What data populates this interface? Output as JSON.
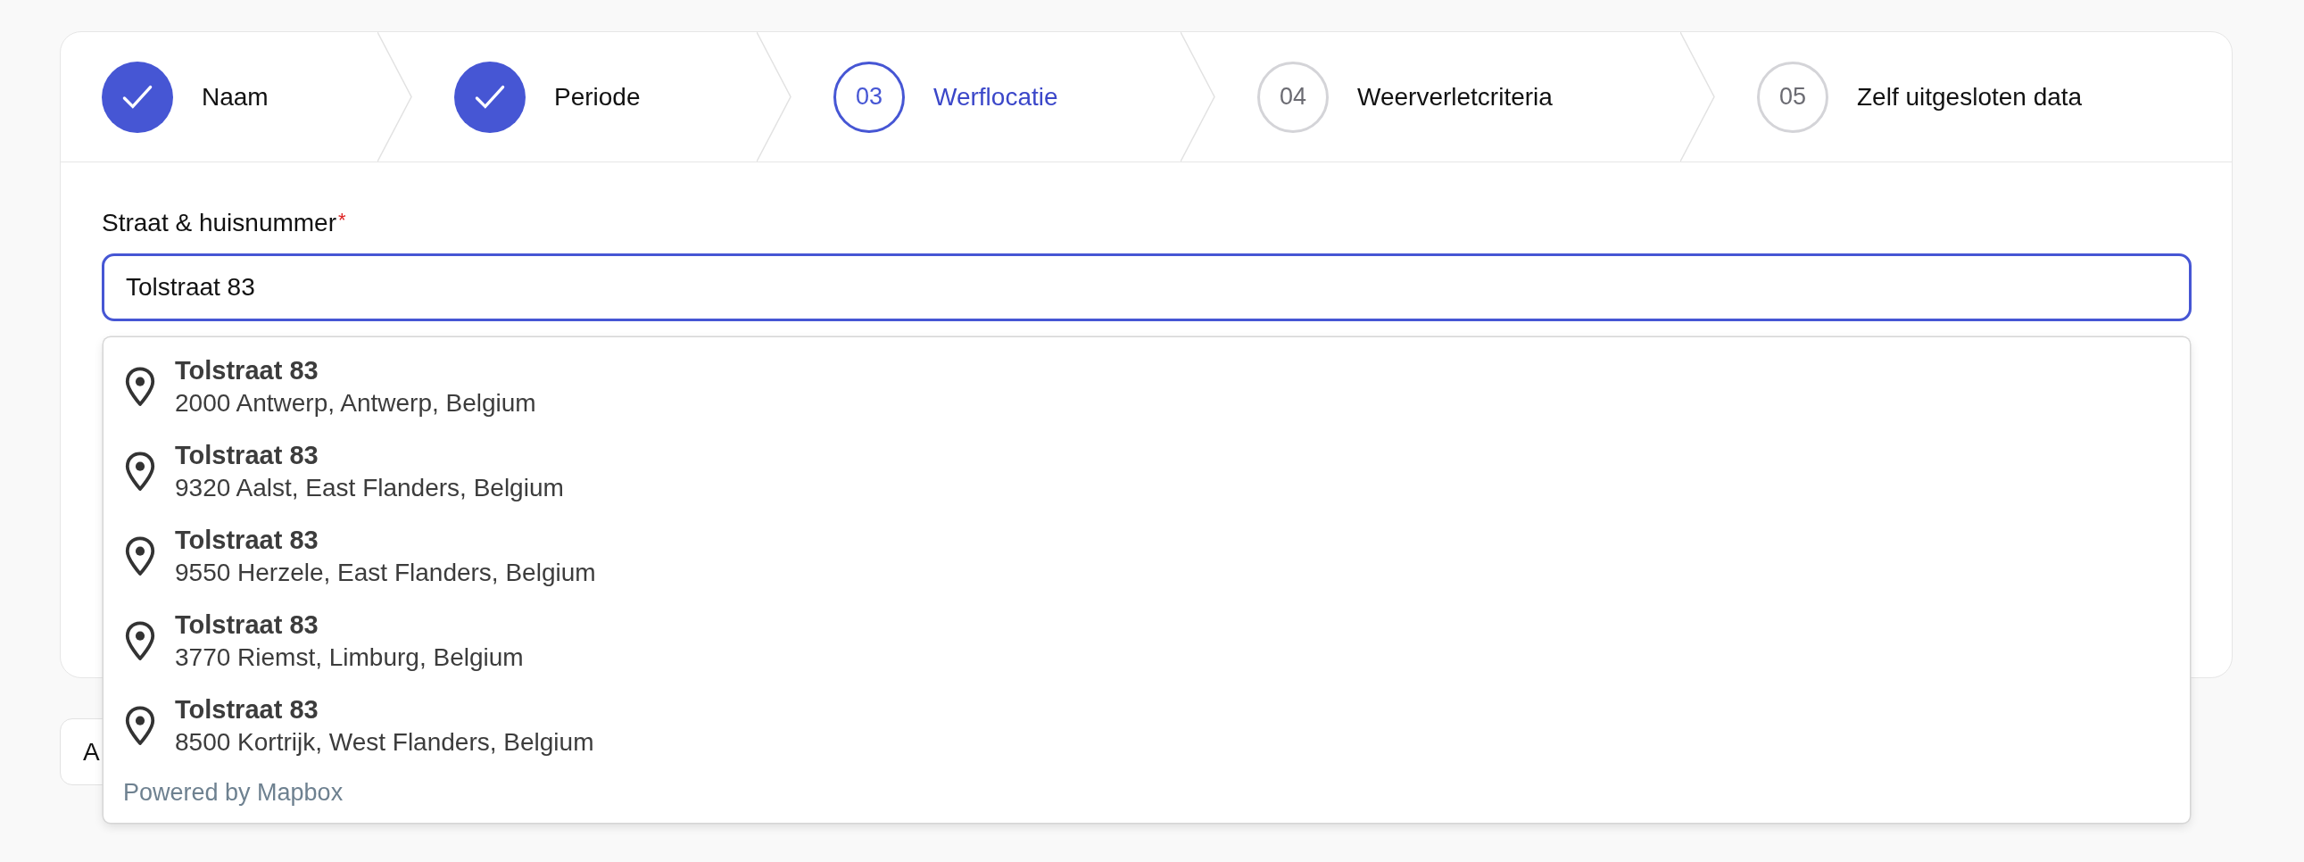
{
  "steps": [
    {
      "label": "Naam",
      "done": true,
      "selected": false
    },
    {
      "label": "Periode",
      "done": true,
      "selected": false
    },
    {
      "number": "03",
      "label": "Werflocatie",
      "done": false,
      "selected": true
    },
    {
      "number": "04",
      "label": "Weerverletcriteria",
      "done": false,
      "selected": false
    },
    {
      "number": "05",
      "label": "Zelf uitgesloten data",
      "done": false,
      "selected": false
    }
  ],
  "address_field": {
    "label": "Straat & huisnummer",
    "required_mark": "*",
    "value": "Tolstraat 83"
  },
  "suggestions": [
    {
      "title": "Tolstraat 83",
      "detail": "2000 Antwerp, Antwerp, Belgium"
    },
    {
      "title": "Tolstraat 83",
      "detail": "9320 Aalst, East Flanders, Belgium"
    },
    {
      "title": "Tolstraat 83",
      "detail": "9550 Herzele, East Flanders, Belgium"
    },
    {
      "title": "Tolstraat 83",
      "detail": "3770 Riemst, Limburg, Belgium"
    },
    {
      "title": "Tolstraat 83",
      "detail": "8500 Kortrijk, West Flanders, Belgium"
    }
  ],
  "attribution": "Powered by Mapbox",
  "footer_button": "A"
}
